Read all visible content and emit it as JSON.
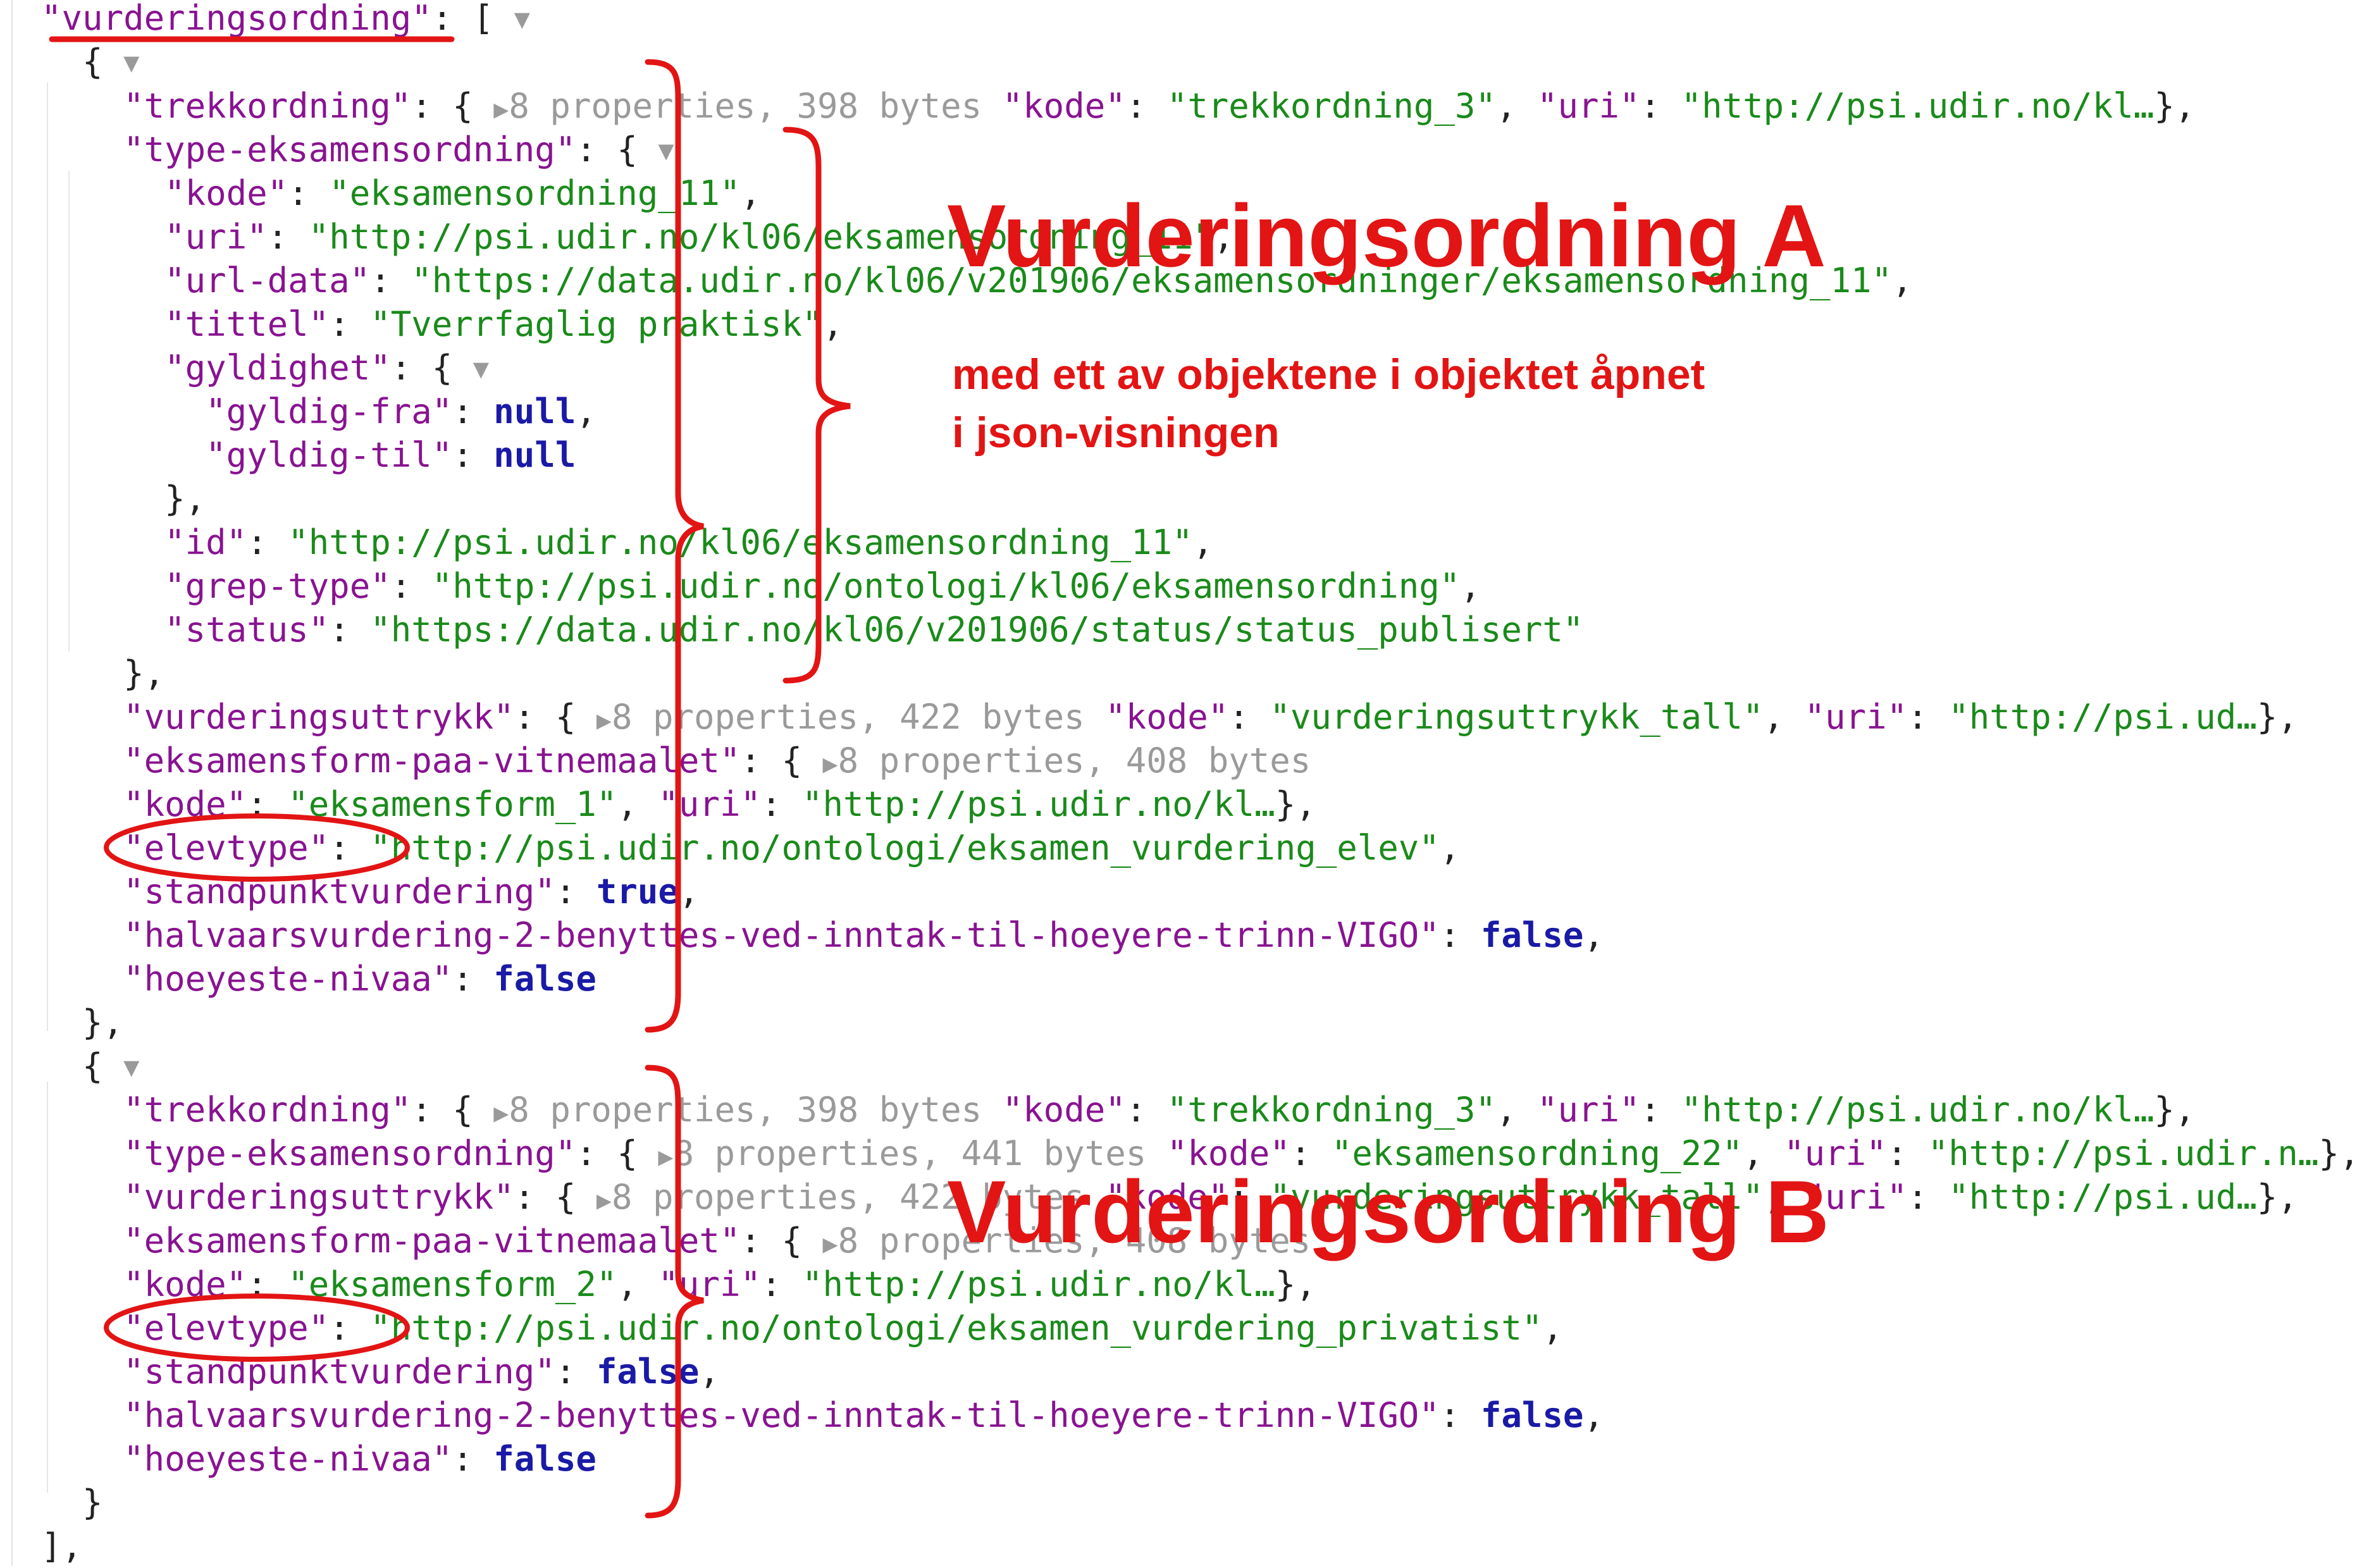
{
  "root_key": "vurderingsordning",
  "toggle_symbol": "▼",
  "collapsed_symbol": "▶",
  "obj_a": {
    "trekkordning": {
      "key": "trekkordning",
      "meta": "8 properties, 398 bytes",
      "preview_key": "kode",
      "preview_value": "trekkordning_3",
      "uri_key": "uri",
      "uri_value": "http://psi.udir.no/kl…"
    },
    "type_eksamensordning": {
      "key": "type-eksamensordning",
      "kode_key": "kode",
      "kode": "eksamensordning_11",
      "uri_key": "uri",
      "uri": "http://psi.udir.no/kl06/eksamensordning_11",
      "url_data_key": "url-data",
      "url_data": "https://data.udir.no/kl06/v201906/eksamensordninger/eksamensordning_11",
      "tittel_key": "tittel",
      "tittel": "Tverrfaglig praktisk",
      "gyldighet_key": "gyldighet",
      "gyldig_fra_key": "gyldig-fra",
      "gyldig_fra": "null",
      "gyldig_til_key": "gyldig-til",
      "gyldig_til": "null",
      "id_key": "id",
      "id": "http://psi.udir.no/kl06/eksamensordning_11",
      "grep_type_key": "grep-type",
      "grep_type": "http://psi.udir.no/ontologi/kl06/eksamensordning",
      "status_key": "status",
      "status": "https://data.udir.no/kl06/v201906/status/status_publisert"
    },
    "vurderingsuttrykk": {
      "key": "vurderingsuttrykk",
      "meta": "8 properties, 422 bytes",
      "preview_key": "kode",
      "preview_value": "vurderingsuttrykk_tall",
      "uri_key": "uri",
      "uri_value": "http://psi.ud…"
    },
    "eksamensform": {
      "key": "eksamensform-paa-vitnemaalet",
      "meta": "8 properties, 408 bytes",
      "preview_key": "kode",
      "preview_value": "eksamensform_1",
      "uri_key": "uri",
      "uri_value": "http://psi.udir.no/kl…"
    },
    "elevtype_key": "elevtype",
    "elevtype": "http://psi.udir.no/ontologi/eksamen_vurdering_elev",
    "standpunkt_key": "standpunktvurdering",
    "standpunkt": "true",
    "halvaars_key": "halvaarsvurdering-2-benyttes-ved-inntak-til-hoeyere-trinn-VIGO",
    "halvaars": "false",
    "hoeyeste_key": "hoeyeste-nivaa",
    "hoeyeste": "false"
  },
  "obj_b": {
    "trekkordning": {
      "key": "trekkordning",
      "meta": "8 properties, 398 bytes",
      "preview_key": "kode",
      "preview_value": "trekkordning_3",
      "uri_key": "uri",
      "uri_value": "http://psi.udir.no/kl…"
    },
    "type_eksamensordning": {
      "key": "type-eksamensordning",
      "meta": "8 properties, 441 bytes",
      "preview_key": "kode",
      "preview_value": "eksamensordning_22",
      "uri_key": "uri",
      "uri_value": "http://psi.udir.n…"
    },
    "vurderingsuttrykk": {
      "key": "vurderingsuttrykk",
      "meta": "8 properties, 422 bytes",
      "preview_key": "kode",
      "preview_value": "vurderingsuttrykk_tall",
      "uri_key": "uri",
      "uri_value": "http://psi.ud…"
    },
    "eksamensform": {
      "key": "eksamensform-paa-vitnemaalet",
      "meta": "8 properties, 408 bytes",
      "preview_key": "kode",
      "preview_value": "eksamensform_2",
      "uri_key": "uri",
      "uri_value": "http://psi.udir.no/kl…"
    },
    "elevtype_key": "elevtype",
    "elevtype": "http://psi.udir.no/ontologi/eksamen_vurdering_privatist",
    "standpunkt_key": "standpunktvurdering",
    "standpunkt": "false",
    "halvaars_key": "halvaarsvurdering-2-benyttes-ved-inntak-til-hoeyere-trinn-VIGO",
    "halvaars": "false",
    "hoeyeste_key": "hoeyeste-nivaa",
    "hoeyeste": "false"
  },
  "annotations": {
    "title_a": "Vurderingsordning A",
    "title_b": "Vurderingsordning B",
    "note_line1": "med ett av objektene i objektet åpnet",
    "note_line2": "i json-visningen",
    "color": "#e31414"
  }
}
